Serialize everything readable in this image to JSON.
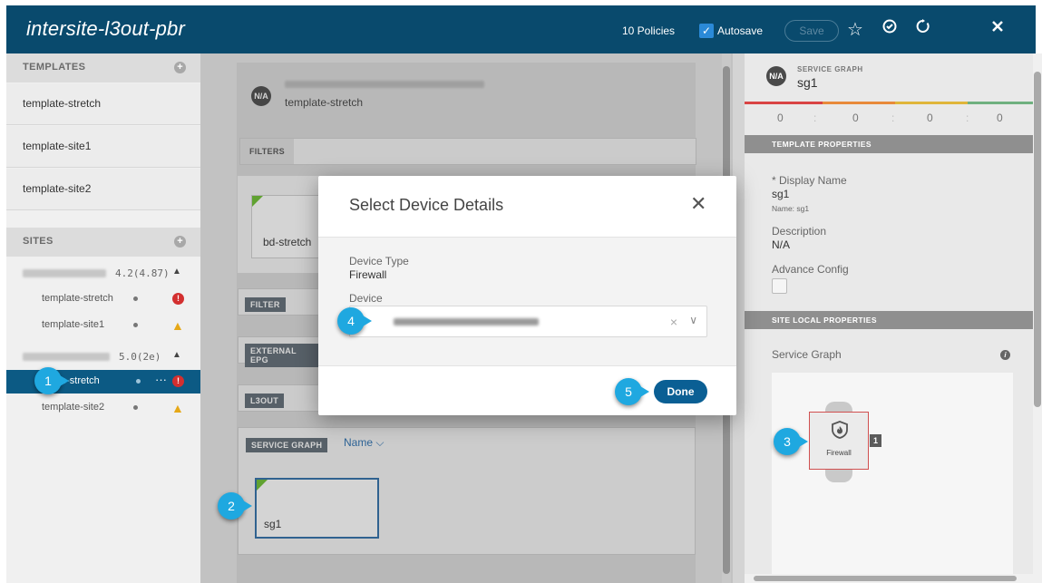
{
  "header": {
    "title": "intersite-l3out-pbr",
    "policies": "10 Policies",
    "autosave_label": "Autosave",
    "save_label": "Save",
    "icons": [
      "star-icon",
      "deploy-icon",
      "refresh-icon",
      "close-icon"
    ]
  },
  "templates": {
    "heading": "TEMPLATES",
    "items": [
      {
        "label": "template-stretch"
      },
      {
        "label": "template-site1"
      },
      {
        "label": "template-site2"
      }
    ]
  },
  "sites": {
    "heading": "SITES",
    "groups": [
      {
        "version": "4.2(4.87)",
        "templates": [
          {
            "label": "template-stretch",
            "status": "error"
          },
          {
            "label": "template-site1",
            "status": "warning"
          }
        ]
      },
      {
        "version": "5.0(2e)",
        "templates": [
          {
            "label": "e-stretch",
            "status": "error",
            "more": "···"
          },
          {
            "label": "template-site2",
            "status": "warning"
          }
        ]
      }
    ]
  },
  "main": {
    "badge": "N/A",
    "template_name": "template-stretch",
    "filters_label": "FILTERS",
    "bd_card": "bd-stretch",
    "filter_tag": "FILTER",
    "external_epg_tag": "EXTERNAL EPG",
    "l3out_tag": "L3OUT",
    "service_graph_tag": "SERVICE GRAPH",
    "sort_label": "Name",
    "sg_card": "sg1"
  },
  "right_panel": {
    "badge": "N/A",
    "kind": "SERVICE GRAPH",
    "name": "sg1",
    "counts": [
      "0",
      "0",
      "0",
      "0"
    ],
    "template_properties": "TEMPLATE PROPERTIES",
    "display_name_label": "* Display Name",
    "display_name_value": "sg1",
    "name_note": "Name: sg1",
    "description_label": "Description",
    "description_value": "N/A",
    "advance_config_label": "Advance Config",
    "site_local_properties": "SITE LOCAL PROPERTIES",
    "service_graph_label": "Service Graph",
    "node_label": "Firewall",
    "node_count": "1"
  },
  "modal": {
    "title": "Select Device Details",
    "device_type_label": "Device Type",
    "device_type_value": "Firewall",
    "device_label": "Device",
    "done_label": "Done"
  },
  "callouts": [
    "1",
    "2",
    "3",
    "4",
    "5"
  ],
  "colors": {
    "header": "#094a6d",
    "accent": "#1fa8e0",
    "done": "#0a5f94",
    "error": "#d32f2f",
    "warning": "#e6a817",
    "new_marker": "#6bbf2f"
  }
}
